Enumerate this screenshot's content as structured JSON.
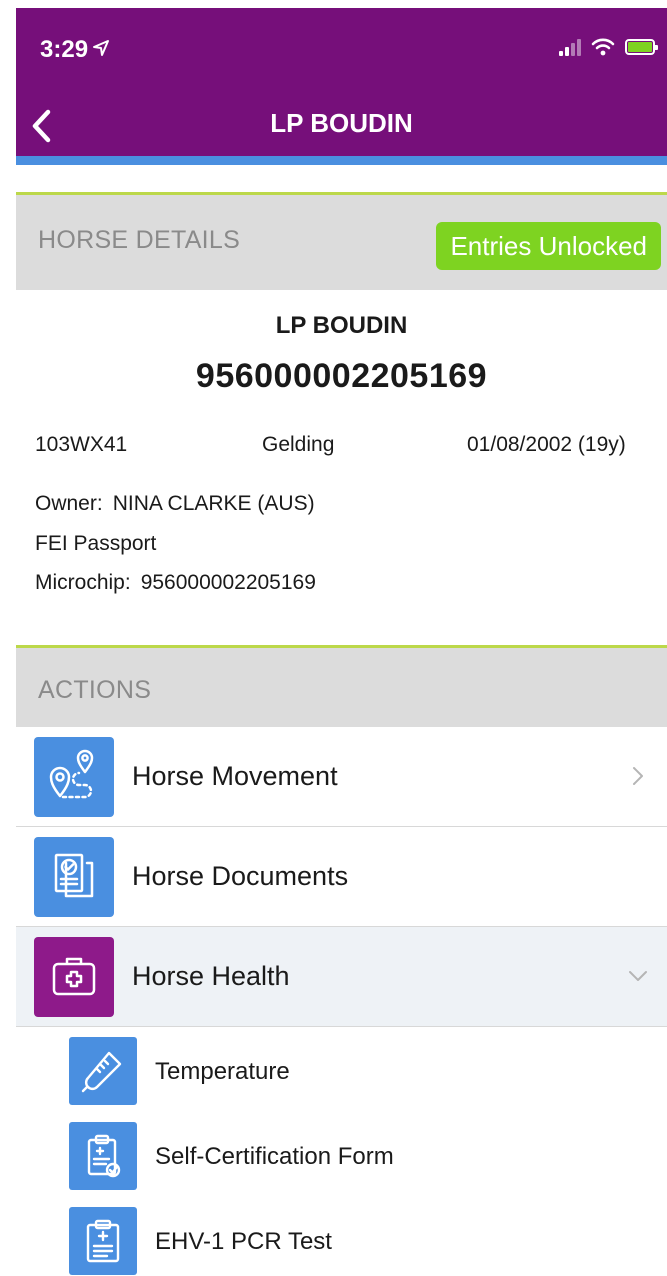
{
  "status_bar": {
    "time": "3:29"
  },
  "nav": {
    "title": "LP BOUDIN"
  },
  "horse_details": {
    "section_title": "HORSE DETAILS",
    "entries_badge": "Entries Unlocked",
    "name": "LP BOUDIN",
    "id_number": "956000002205169",
    "fei_id": "103WX41",
    "sex": "Gelding",
    "dob": "01/08/2002 (19y)",
    "owner_label": "Owner:",
    "owner_value": "NINA CLARKE (AUS)",
    "passport": "FEI Passport",
    "microchip_label": "Microchip:",
    "microchip_value": "956000002205169"
  },
  "actions": {
    "section_title": "ACTIONS",
    "items": [
      {
        "label": "Horse Movement",
        "icon": "map-route-icon"
      },
      {
        "label": "Horse Documents",
        "icon": "documents-icon"
      },
      {
        "label": "Horse Health",
        "icon": "medical-kit-icon"
      }
    ],
    "health_sub_items": [
      {
        "label": "Temperature",
        "icon": "thermometer-icon"
      },
      {
        "label": "Self-Certification Form",
        "icon": "clipboard-check-icon"
      },
      {
        "label": "EHV-1 PCR Test",
        "icon": "clipboard-medical-icon"
      }
    ]
  },
  "colors": {
    "header_purple": "#760f7a",
    "accent_blue": "#4a8fe0",
    "accent_green": "#7ed321",
    "divider_green": "#bcd84a",
    "health_purple": "#8e1a8a"
  }
}
